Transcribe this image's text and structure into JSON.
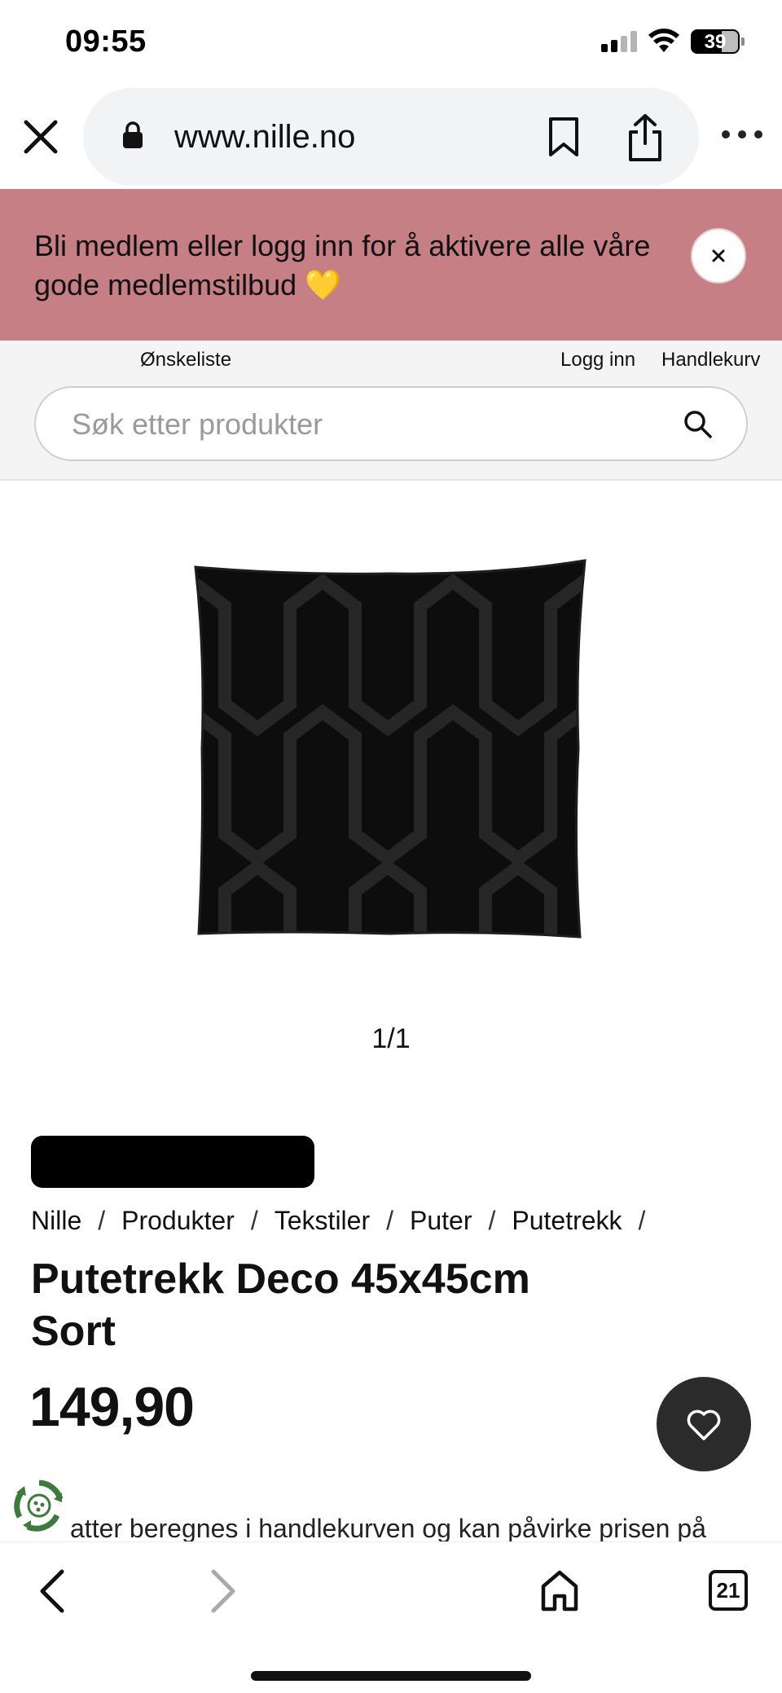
{
  "status_bar": {
    "time": "09:55",
    "battery_level": "39"
  },
  "browser": {
    "url": "www.nille.no",
    "tab_count": "21"
  },
  "banner": {
    "text": "Bli medlem eller logg inn for å aktivere alle våre gode medlemstilbud 💛"
  },
  "header": {
    "wishlist_label": "Ønskeliste",
    "login_label": "Logg inn",
    "cart_label": "Handlekurv",
    "search_placeholder": "Søk etter produkter"
  },
  "gallery": {
    "pager": "1/1"
  },
  "product": {
    "breadcrumb": [
      "Nille",
      "Produkter",
      "Tekstiler",
      "Puter",
      "Putetrekk"
    ],
    "title": "Putetrekk Deco 45x45cm Sort",
    "price": "149,90",
    "info_text": "atter beregnes i handlekurven og kan påvirke prisen på"
  },
  "colors": {
    "banner_bg": "#c57f85",
    "fab_bg": "#2b2b2b"
  },
  "icons": {
    "close": "close-icon",
    "lock": "lock-icon",
    "bookmark": "bookmark-icon",
    "share": "share-icon",
    "more": "more-icon",
    "search": "search-icon",
    "heart": "heart-icon",
    "back": "chevron-left-icon",
    "forward": "chevron-right-icon",
    "home": "home-icon",
    "tabs": "tabs-icon",
    "eco": "recycle-icon"
  }
}
